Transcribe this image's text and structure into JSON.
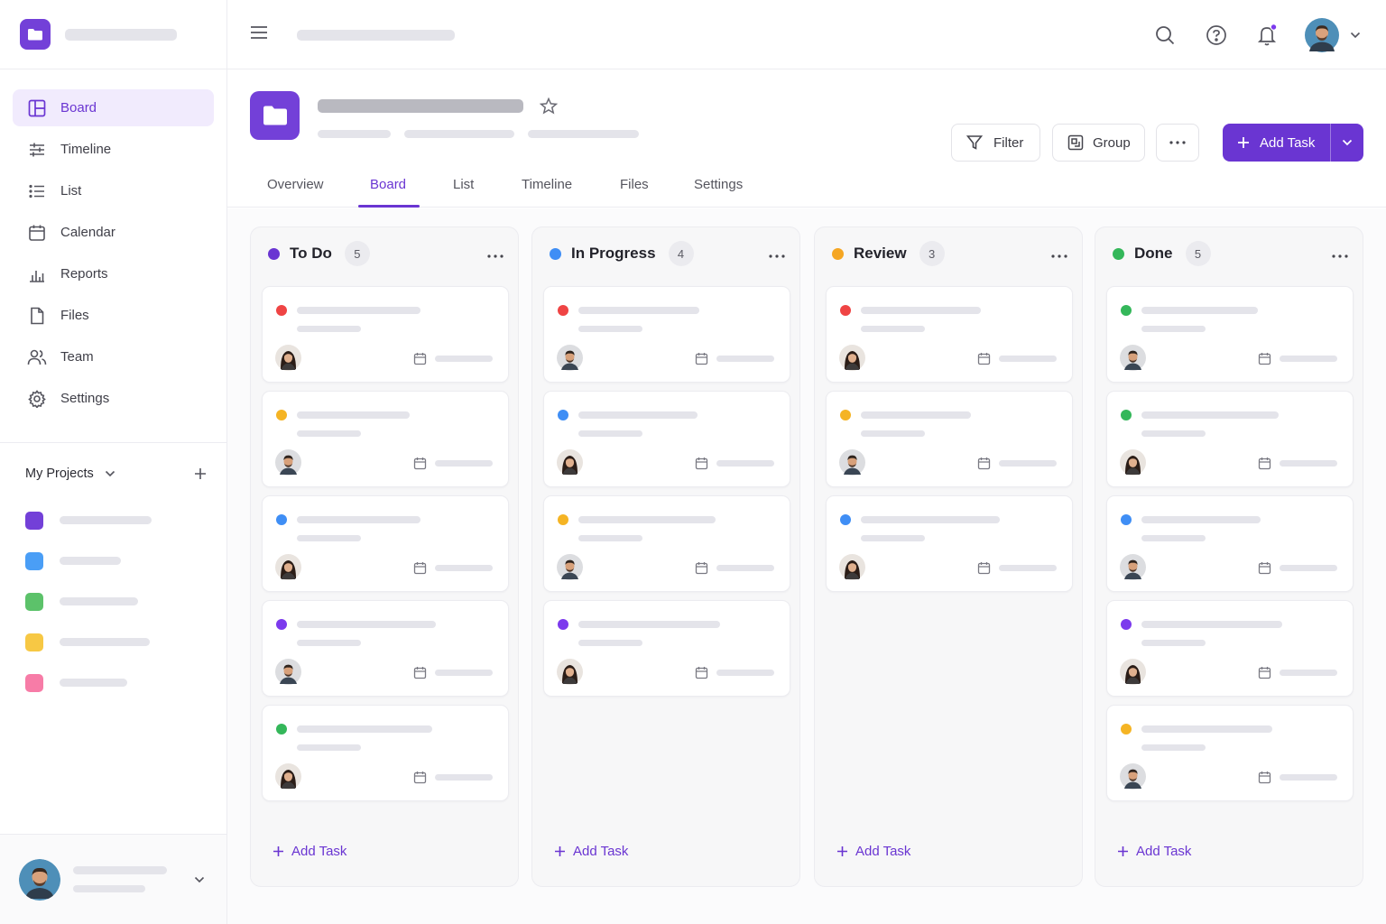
{
  "sidebar": {
    "nav": [
      {
        "label": "Board",
        "icon": "board-icon",
        "active": true
      },
      {
        "label": "Timeline",
        "icon": "timeline-icon"
      },
      {
        "label": "List",
        "icon": "list-icon"
      },
      {
        "label": "Calendar",
        "icon": "calendar-icon"
      },
      {
        "label": "Reports",
        "icon": "reports-icon"
      },
      {
        "label": "Files",
        "icon": "file-icon"
      },
      {
        "label": "Team",
        "icon": "team-icon"
      },
      {
        "label": "Settings",
        "icon": "gear-icon"
      }
    ],
    "projects_title": "My Projects",
    "project_colors": [
      "#7340d8",
      "#4a9ef6",
      "#5cc26a",
      "#f7c844",
      "#f77ca7"
    ]
  },
  "header": {
    "tabs": [
      "Overview",
      "Board",
      "List",
      "Timeline",
      "Files",
      "Settings"
    ],
    "active_tab": "Board",
    "filter_label": "Filter",
    "group_label": "Group",
    "add_task_label": "Add Task"
  },
  "colors": {
    "accent": "#6a35d2",
    "red": "#ef4444",
    "yellow": "#f5b424",
    "blue": "#3f8ef5",
    "purple": "#7c3aed",
    "green": "#34b75a"
  },
  "board": {
    "add_task_label": "Add Task",
    "columns": [
      {
        "title": "To Do",
        "count": "5",
        "dot": "#6a35d2",
        "cards": [
          {
            "priority": "#ef4444",
            "avatar": "female"
          },
          {
            "priority": "#f5b424",
            "avatar": "male"
          },
          {
            "priority": "#3f8ef5",
            "avatar": "female"
          },
          {
            "priority": "#7c3aed",
            "avatar": "male"
          },
          {
            "priority": "#34b75a",
            "avatar": "female"
          }
        ]
      },
      {
        "title": "In Progress",
        "count": "4",
        "dot": "#3f8ef5",
        "cards": [
          {
            "priority": "#ef4444",
            "avatar": "male"
          },
          {
            "priority": "#3f8ef5",
            "avatar": "female"
          },
          {
            "priority": "#f5b424",
            "avatar": "male"
          },
          {
            "priority": "#7c3aed",
            "avatar": "female"
          }
        ]
      },
      {
        "title": "Review",
        "count": "3",
        "dot": "#f5a623",
        "cards": [
          {
            "priority": "#ef4444",
            "avatar": "female"
          },
          {
            "priority": "#f5b424",
            "avatar": "male"
          },
          {
            "priority": "#3f8ef5",
            "avatar": "female"
          }
        ]
      },
      {
        "title": "Done",
        "count": "5",
        "dot": "#34b75a",
        "cards": [
          {
            "priority": "#34b75a",
            "avatar": "male"
          },
          {
            "priority": "#34b75a",
            "avatar": "female"
          },
          {
            "priority": "#3f8ef5",
            "avatar": "male"
          },
          {
            "priority": "#7c3aed",
            "avatar": "female"
          },
          {
            "priority": "#f5b424",
            "avatar": "male"
          }
        ]
      }
    ]
  }
}
